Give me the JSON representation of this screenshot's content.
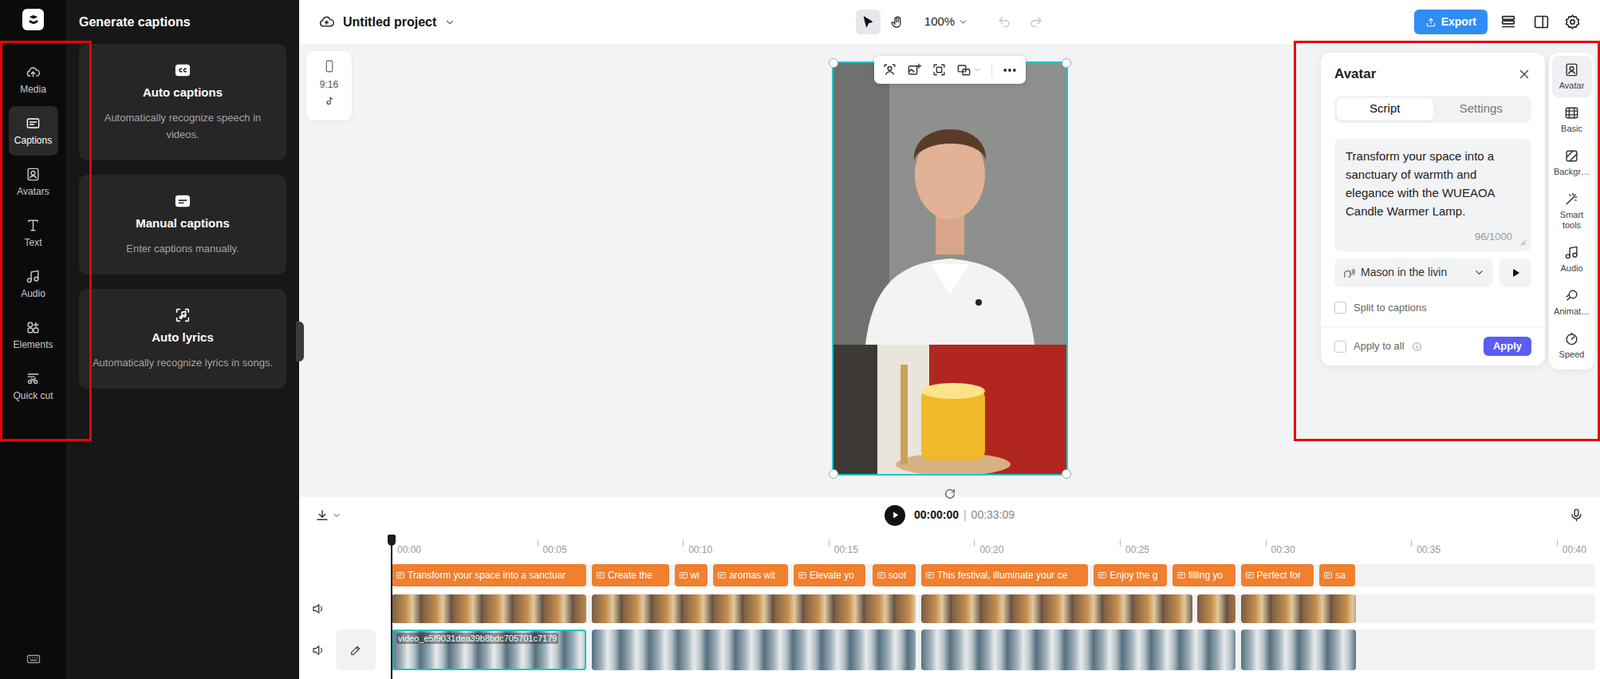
{
  "project": {
    "title": "Untitled project",
    "zoom": "100%",
    "export": "Export"
  },
  "tools": [
    {
      "kind": "pointer",
      "selected": true
    },
    {
      "kind": "hand",
      "selected": false
    }
  ],
  "history": {
    "undo_disabled": true,
    "redo_disabled": true
  },
  "left_rail": [
    {
      "label": "Media",
      "kind": "media",
      "selected": false
    },
    {
      "label": "Captions",
      "kind": "captions",
      "selected": true
    },
    {
      "label": "Avatars",
      "kind": "avatars",
      "selected": false
    },
    {
      "label": "Text",
      "kind": "text",
      "selected": false
    },
    {
      "label": "Audio",
      "kind": "audio",
      "selected": false
    },
    {
      "label": "Elements",
      "kind": "elements",
      "selected": false
    },
    {
      "label": "Quick cut",
      "kind": "quickcut",
      "selected": false
    }
  ],
  "captions_panel": {
    "title": "Generate captions",
    "cards": [
      {
        "kind": "auto",
        "title": "Auto captions",
        "description": "Automatically recognize speech in videos."
      },
      {
        "kind": "manual",
        "title": "Manual captions",
        "description": "Enter captions manually."
      },
      {
        "kind": "lyrics",
        "title": "Auto lyrics",
        "description": "Automatically recognize lyrics in songs."
      }
    ]
  },
  "canvas": {
    "aspect_ratio": "9:16",
    "selected": true
  },
  "avatar_panel": {
    "title": "Avatar",
    "tabs": [
      {
        "label": "Script",
        "selected": true
      },
      {
        "label": "Settings",
        "selected": false
      }
    ],
    "script": "Transform your space into a sanctuary of warmth and elegance with the WUEAOA Candle Warmer Lamp.",
    "char_count": "96/1000",
    "voice": "Mason in the livin",
    "split_to_captions": {
      "label": "Split to captions",
      "checked": false
    },
    "apply_to_all": {
      "label": "Apply to all",
      "checked": false
    },
    "apply": "Apply"
  },
  "right_rail": [
    {
      "label": "Avatar",
      "kind": "avatar",
      "selected": true
    },
    {
      "label": "Basic",
      "kind": "basic",
      "selected": false
    },
    {
      "label": "Backgr…",
      "kind": "background",
      "selected": false
    },
    {
      "label": "Smart tools",
      "kind": "smart",
      "selected": false
    },
    {
      "label": "Audio",
      "kind": "audio",
      "selected": false
    },
    {
      "label": "Animat…",
      "kind": "animation",
      "selected": false
    },
    {
      "label": "Speed",
      "kind": "speed",
      "selected": false
    }
  ],
  "playback": {
    "current": "00:00:00",
    "separator": "|",
    "total": "00:33:09",
    "playing": false
  },
  "timeline": {
    "ticks": [
      "00:00",
      "00:05",
      "00:10",
      "00:15",
      "00:20",
      "00:25",
      "00:30",
      "00:35",
      "00:40"
    ],
    "playhead": 0,
    "captions": [
      {
        "text": "Transform your space into a sanctuar",
        "start": 0,
        "end": 6.76
      },
      {
        "text": "Create the",
        "start": 6.87,
        "end": 9.6
      },
      {
        "text": "wi",
        "start": 9.71,
        "end": 10.93
      },
      {
        "text": "aromas wit",
        "start": 11.04,
        "end": 13.7
      },
      {
        "text": "Elevate yo",
        "start": 13.8,
        "end": 16.36
      },
      {
        "text": "soot",
        "start": 16.5,
        "end": 18.08
      },
      {
        "text": "This festival, illuminate your ce",
        "start": 18.18,
        "end": 24.0
      },
      {
        "text": "Enjoy the g",
        "start": 24.11,
        "end": 26.7
      },
      {
        "text": "filling yo",
        "start": 26.8,
        "end": 29.05
      },
      {
        "text": "Perfect for",
        "start": 29.15,
        "end": 31.75
      },
      {
        "text": "sa",
        "start": 31.85,
        "end": 33.15
      }
    ],
    "video": [
      {
        "start": 0,
        "end": 6.76
      },
      {
        "start": 6.87,
        "end": 18.08
      },
      {
        "start": 18.18,
        "end": 27.58
      },
      {
        "start": 27.65,
        "end": 29.05
      },
      {
        "start": 29.15,
        "end": 33.18
      }
    ],
    "avatar": [
      {
        "label": "video_e5f9031dea39b8bdc705701c7179",
        "start": 0,
        "end": 6.76,
        "selected": true
      },
      {
        "label": "",
        "start": 6.87,
        "end": 18.08,
        "selected": false
      },
      {
        "label": "",
        "start": 18.18,
        "end": 29.05,
        "selected": false
      },
      {
        "label": "",
        "start": 29.15,
        "end": 33.18,
        "selected": false
      }
    ]
  }
}
